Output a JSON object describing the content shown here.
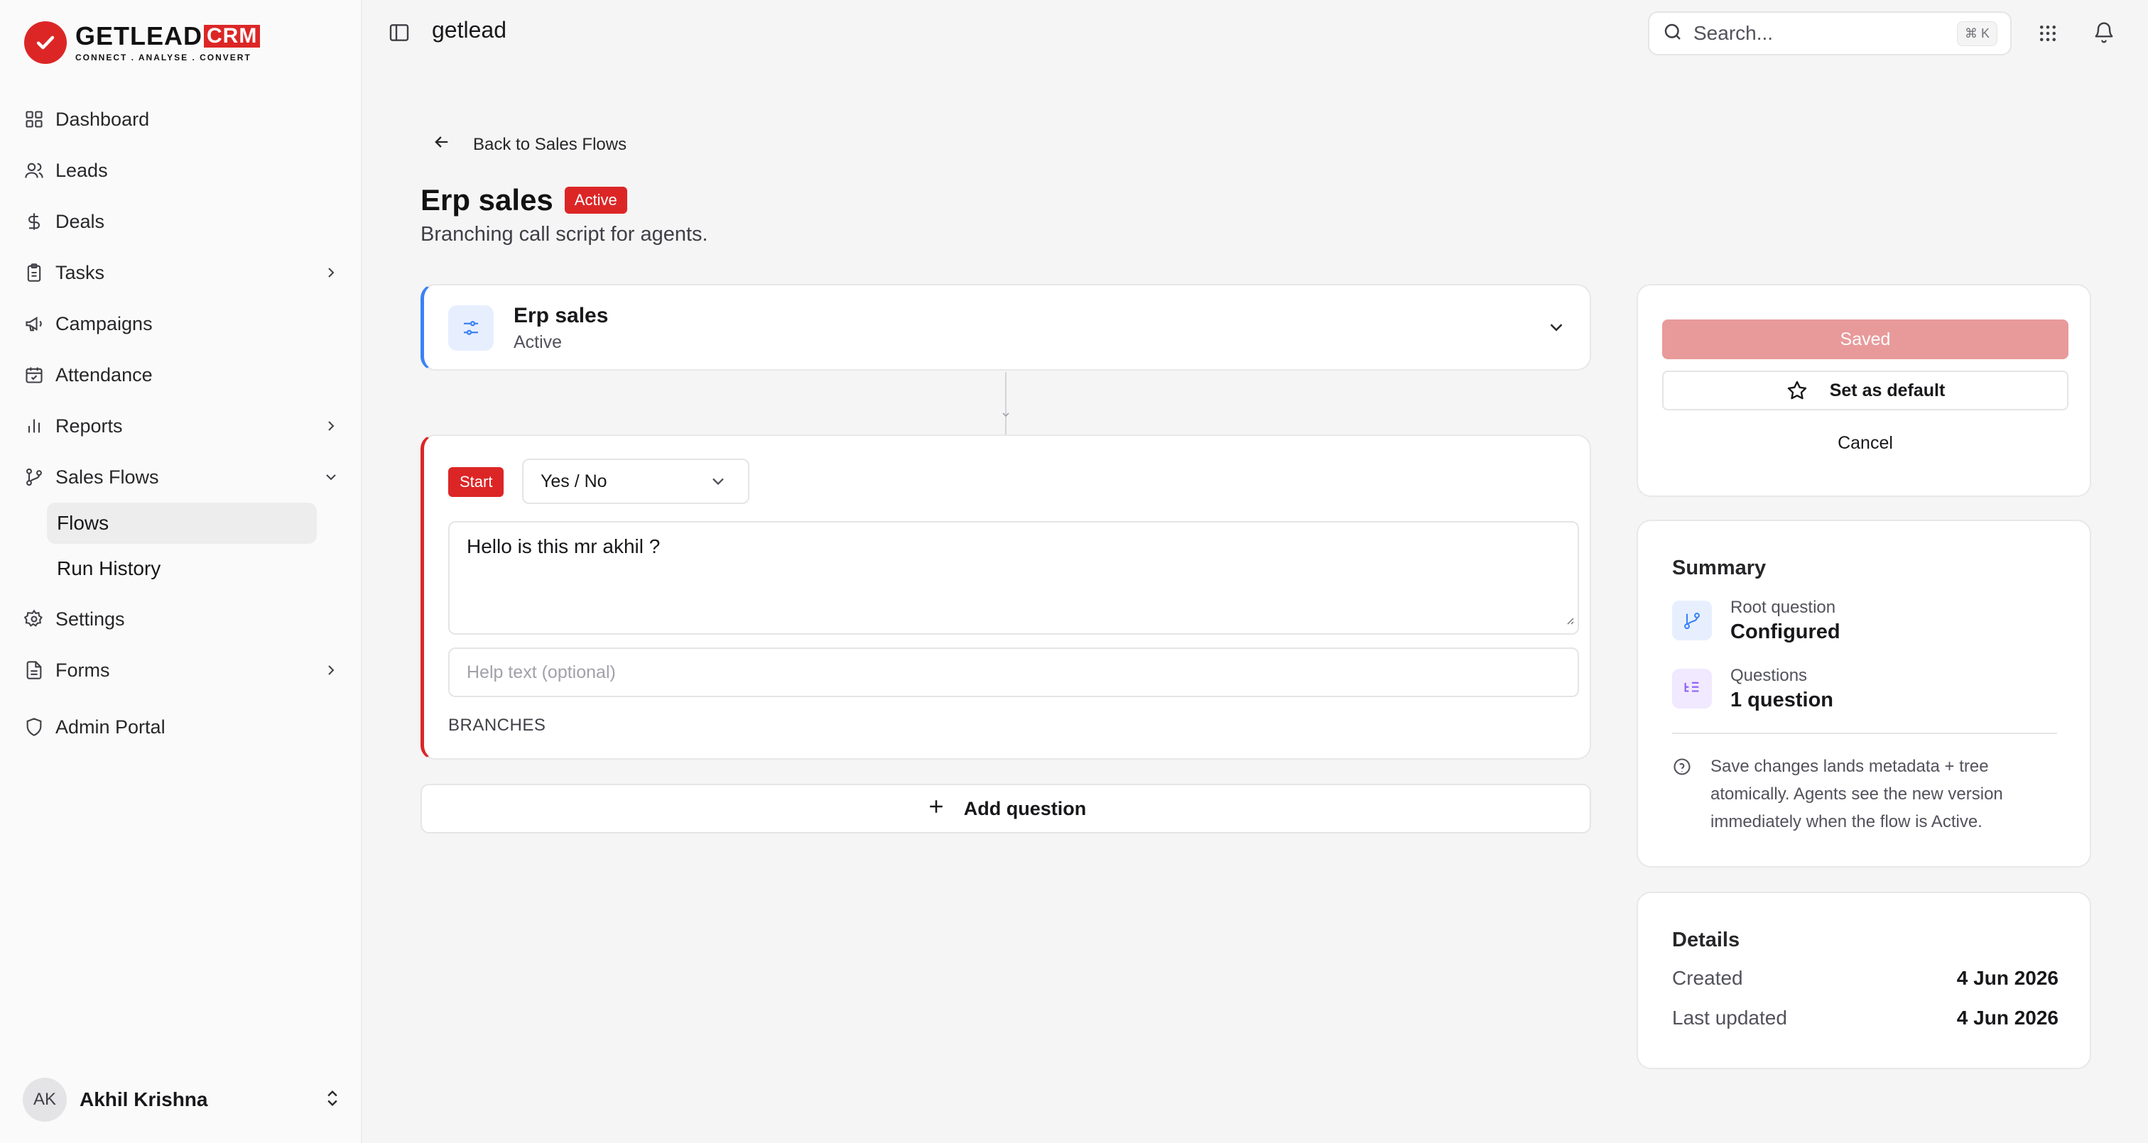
{
  "brand": {
    "logo_main": "GETLEAD",
    "logo_crm": "CRM",
    "logo_sub": "CONNECT . ANALYSE . CONVERT",
    "color": "#dc2626"
  },
  "sidebar": {
    "items": [
      {
        "label": "Dashboard",
        "icon": "grid-icon"
      },
      {
        "label": "Leads",
        "icon": "users-icon"
      },
      {
        "label": "Deals",
        "icon": "dollar-icon"
      },
      {
        "label": "Tasks",
        "icon": "clipboard-icon"
      },
      {
        "label": "Campaigns",
        "icon": "megaphone-icon"
      },
      {
        "label": "Attendance",
        "icon": "calendar-icon"
      },
      {
        "label": "Reports",
        "icon": "bar-chart-icon"
      },
      {
        "label": "Sales Flows",
        "icon": "git-branch-icon"
      },
      {
        "label": "Settings",
        "icon": "gear-icon"
      },
      {
        "label": "Forms",
        "icon": "file-icon"
      },
      {
        "label": "Admin Portal",
        "icon": "shield-icon"
      }
    ],
    "sub_items": [
      {
        "label": "Flows",
        "active": true
      },
      {
        "label": "Run History",
        "active": false
      }
    ],
    "user": {
      "initials": "AK",
      "name": "Akhil Krishna"
    }
  },
  "topbar": {
    "title": "getlead",
    "search_placeholder": "Search...",
    "search_shortcut": "⌘ K"
  },
  "page": {
    "back_label": "Back to Sales Flows",
    "title": "Erp sales",
    "status": "Active",
    "subtitle": "Branching call script for agents."
  },
  "flow": {
    "name": "Erp sales",
    "status": "Active"
  },
  "question": {
    "start_label": "Start",
    "type": "Yes / No",
    "text": "Hello is this mr akhil ?",
    "help_placeholder": "Help text (optional)",
    "branches_label": "BRANCHES"
  },
  "add_question_label": "Add question",
  "actions": {
    "saved_label": "Saved",
    "default_label": "Set as default",
    "cancel_label": "Cancel"
  },
  "summary": {
    "title": "Summary",
    "root_label": "Root question",
    "root_value": "Configured",
    "questions_label": "Questions",
    "questions_value": "1 question",
    "note": "Save changes lands metadata + tree atomically. Agents see the new version immediately when the flow is Active."
  },
  "details": {
    "title": "Details",
    "created_label": "Created",
    "created_value": "4 Jun 2026",
    "updated_label": "Last updated",
    "updated_value": "4 Jun 2026"
  }
}
